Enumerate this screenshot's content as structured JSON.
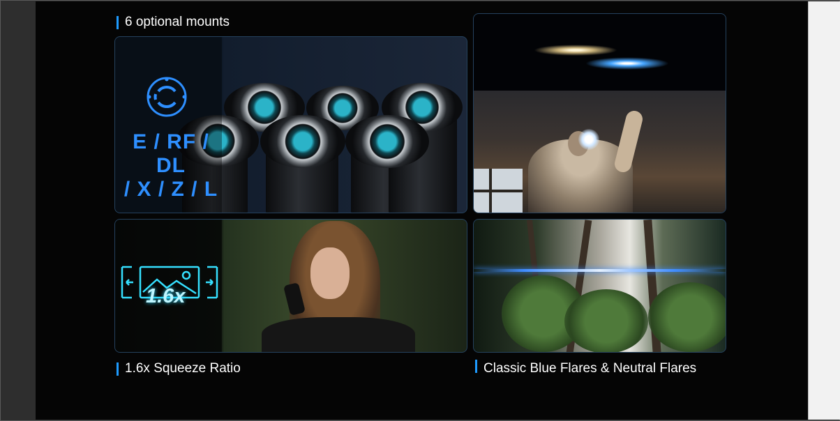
{
  "captions": {
    "mounts": "6 optional mounts",
    "squeeze": "1.6x Squeeze Ratio",
    "flares": "Classic Blue Flares & Neutral Flares"
  },
  "overlays": {
    "mounts_line1": "E / RF / DL",
    "mounts_line2": "/ X / Z / L",
    "squeeze_value": "1.6x"
  },
  "icons": {
    "mount": "mount-ring-icon",
    "squeeze": "anamorphic-squeeze-icon"
  },
  "colors": {
    "accent_bar": "#1e9bff",
    "mount_text": "#2e8fff",
    "squeeze_glow": "#2fd9ff",
    "page_background": "#050505"
  }
}
